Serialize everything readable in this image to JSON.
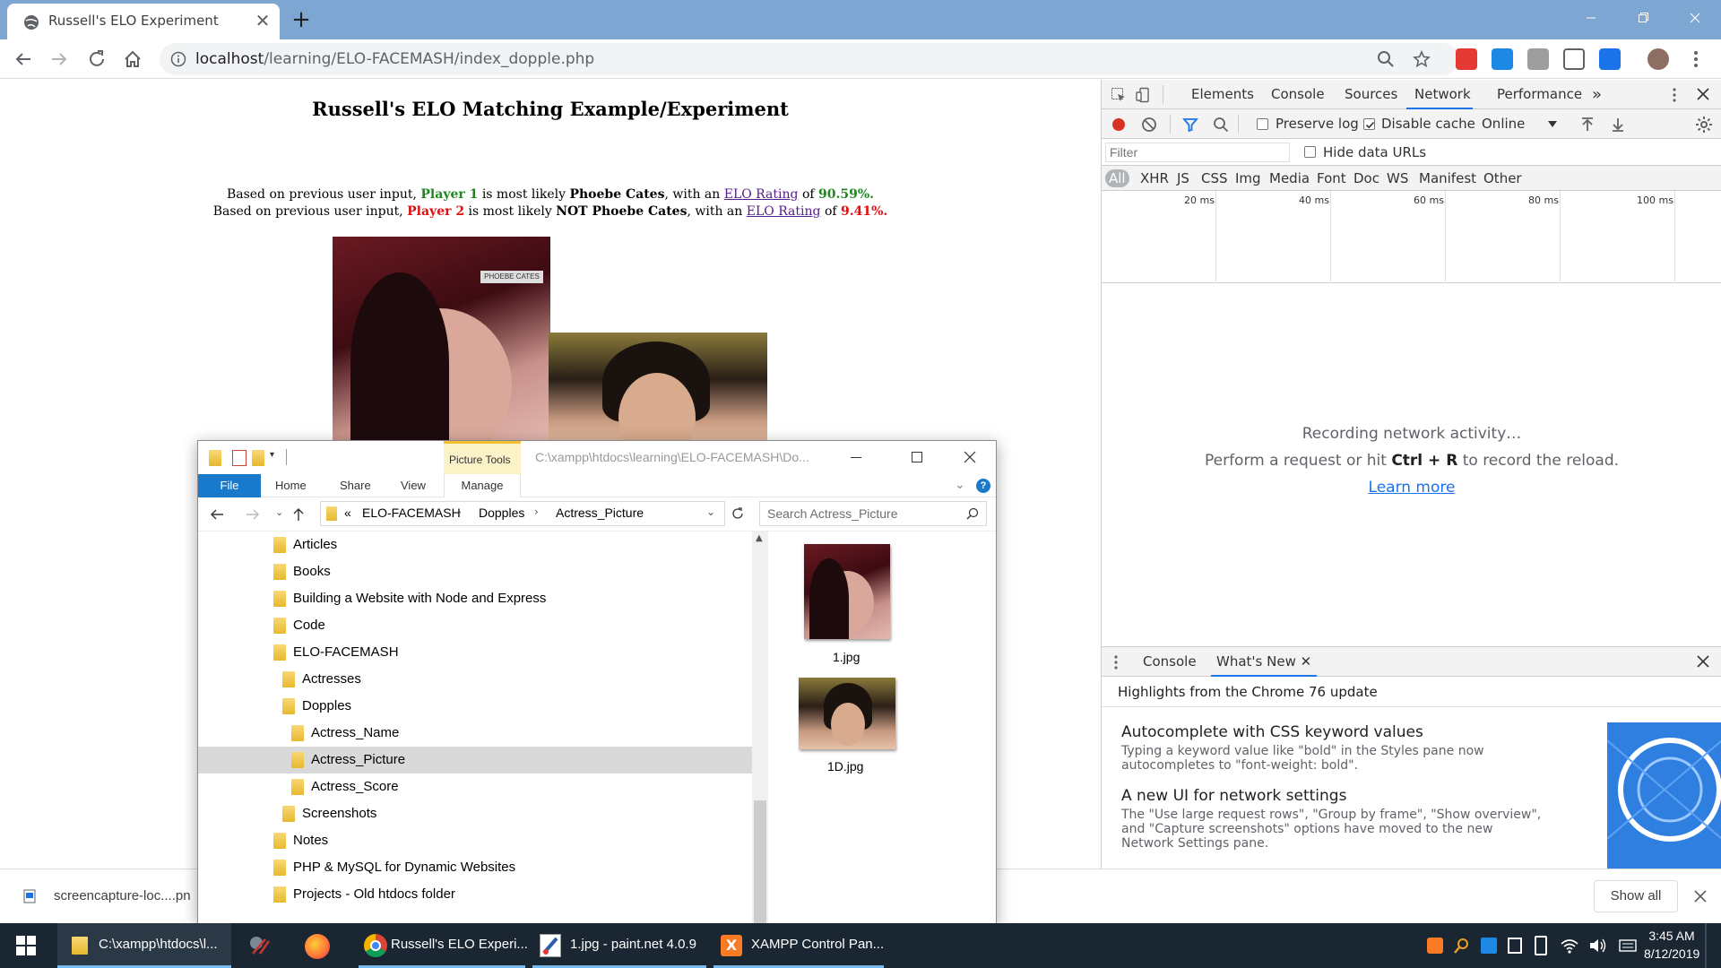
{
  "browser": {
    "tab_title": "Russell's ELO Experiment",
    "tab_close": "✕",
    "new_tab": "+",
    "url_host": "localhost",
    "url_path": "/learning/ELO-FACEMASH/index_dopple.php"
  },
  "page": {
    "title": "Russell's ELO Matching Example/Experiment",
    "line1": {
      "prefix": "Based on previous user input,",
      "player": "Player 1",
      "mid": "is most likely",
      "name": "Phoebe Cates",
      "with": ", with an",
      "link": "ELO Rating",
      "of": "of",
      "value": "90.59%."
    },
    "line2": {
      "prefix": "Based on previous user input,",
      "player": "Player 2",
      "mid": "is most likely",
      "name": "NOT Phoebe Cates",
      "with": ", with an",
      "link": "ELO Rating",
      "of": "of",
      "value": "9.41%."
    },
    "photo1_caption": "PHOEBE CATES"
  },
  "devtools": {
    "tabs": [
      "Elements",
      "Console",
      "Sources",
      "Network",
      "Performance"
    ],
    "more": "»",
    "preserve_log": "Preserve log",
    "disable_cache": "Disable cache",
    "throttle": "Online",
    "filter_placeholder": "Filter",
    "hide_data_urls": "Hide data URLs",
    "types": [
      "All",
      "XHR",
      "JS",
      "CSS",
      "Img",
      "Media",
      "Font",
      "Doc",
      "WS",
      "Manifest",
      "Other"
    ],
    "ticks": [
      "20 ms",
      "40 ms",
      "60 ms",
      "80 ms",
      "100 ms"
    ],
    "recording": "Recording network activity…",
    "hint_pre": "Perform a request or hit",
    "hint_key": "Ctrl + R",
    "hint_post": "to record the reload.",
    "learn_more": "Learn more",
    "drawer": {
      "tab_console": "Console",
      "tab_whatsnew": "What's New",
      "highlights": "Highlights from the Chrome 76 update",
      "items": [
        {
          "title": "Autocomplete with CSS keyword values",
          "desc1": "Typing a keyword value like \"bold\" in the Styles pane now",
          "desc2": "autocompletes to \"font-weight: bold\"."
        },
        {
          "title": "A new UI for network settings",
          "desc1": "The \"Use large request rows\", \"Group by frame\", \"Show overview\",",
          "desc2": "and \"Capture screenshots\" options have moved to the new",
          "desc3": "Network Settings pane."
        }
      ]
    }
  },
  "downloads": {
    "file": "screencapture-loc....pn",
    "show_all": "Show all"
  },
  "explorer": {
    "picture_tools": "Picture Tools",
    "path_title": "C:\\xampp\\htdocs\\learning\\ELO-FACEMASH\\Do...",
    "ribbon": [
      "File",
      "Home",
      "Share",
      "View",
      "Manage"
    ],
    "crumbs": [
      "«",
      "ELO-FACEMASH",
      "Dopples",
      "Actress_Picture"
    ],
    "search_placeholder": "Search Actress_Picture",
    "tree": [
      {
        "label": "Articles",
        "depth": 0
      },
      {
        "label": "Books",
        "depth": 0
      },
      {
        "label": "Building a Website with Node and Express",
        "depth": 0
      },
      {
        "label": "Code",
        "depth": 0
      },
      {
        "label": "ELO-FACEMASH",
        "depth": 0
      },
      {
        "label": "Actresses",
        "depth": 1
      },
      {
        "label": "Dopples",
        "depth": 1
      },
      {
        "label": "Actress_Name",
        "depth": 2
      },
      {
        "label": "Actress_Picture",
        "depth": 2,
        "selected": true
      },
      {
        "label": "Actress_Score",
        "depth": 2
      },
      {
        "label": "Screenshots",
        "depth": 1
      },
      {
        "label": "Notes",
        "depth": 0
      },
      {
        "label": "PHP & MySQL for Dynamic Websites",
        "depth": 0
      },
      {
        "label": "Projects - Old htdocs folder",
        "depth": 0
      }
    ],
    "files": [
      "1.jpg",
      "1D.jpg"
    ]
  },
  "taskbar": {
    "items": [
      {
        "label": "C:\\xampp\\htdocs\\l...",
        "icon": "folder-icon"
      },
      {
        "label": "",
        "icon": "snipping-tool-icon"
      },
      {
        "label": "",
        "icon": "firefox-icon"
      },
      {
        "label": "Russell's ELO Experi...",
        "icon": "chrome-icon"
      },
      {
        "label": "1.jpg - paint.net 4.0.9",
        "icon": "paintnet-icon"
      },
      {
        "label": "XAMPP Control Pan...",
        "icon": "xampp-icon"
      }
    ],
    "time": "3:45 AM",
    "date": "8/12/2019"
  }
}
